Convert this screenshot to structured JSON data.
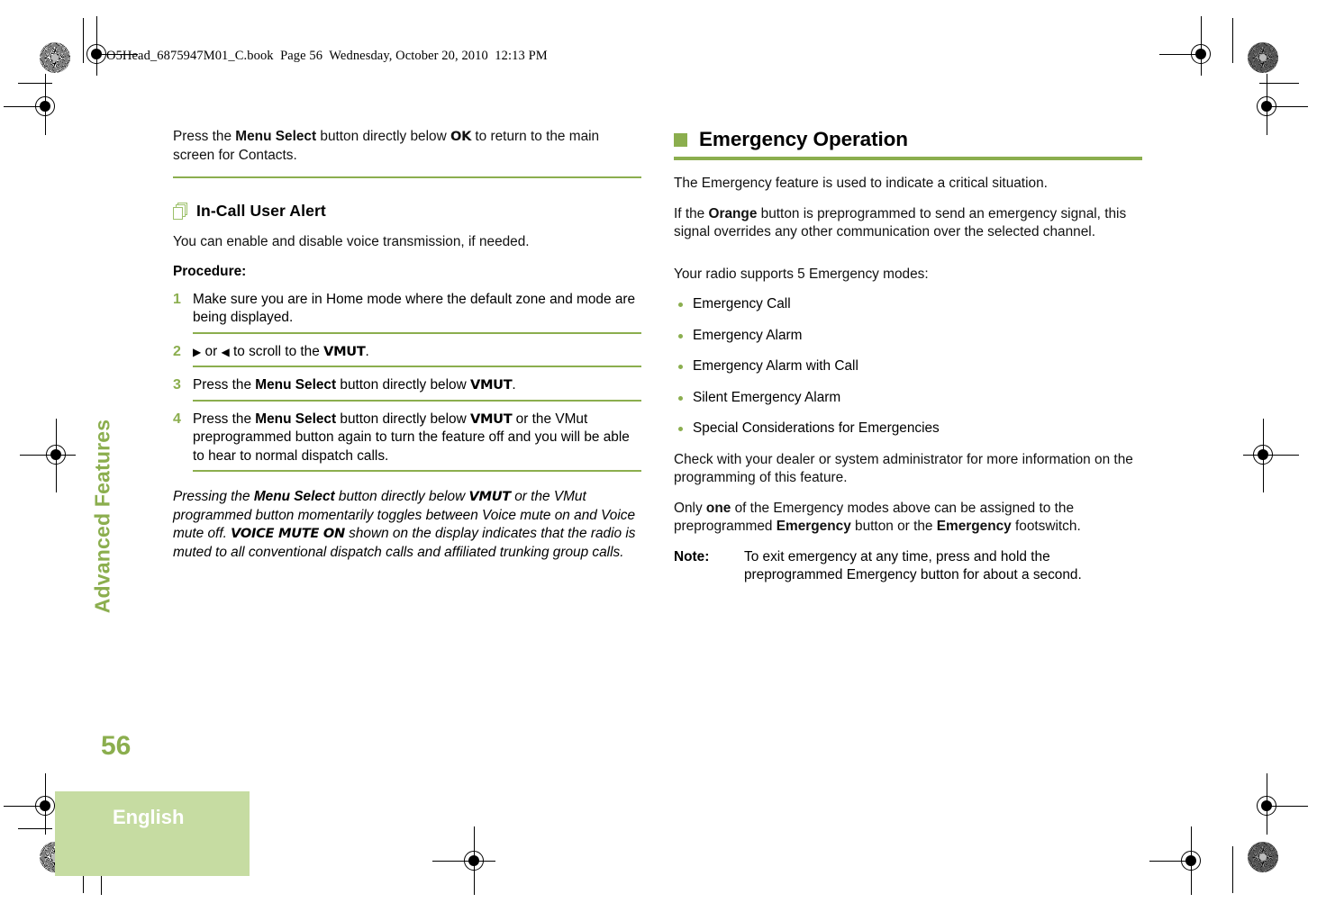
{
  "document": {
    "file_header": "O5Head_6875947M01_C.book  Page 56  Wednesday, October 20, 2010  12:13 PM",
    "chapter_tab": "Advanced Features",
    "page_number": "56",
    "language_label": "English",
    "accent_color": "#8BAE4E",
    "light_accent_color": "#C6DCA2"
  },
  "left_column": {
    "intro": {
      "part1": "Press the ",
      "bold1": "Menu Select",
      "part2": " button directly below ",
      "display1": "OK",
      "part3": " to return to the main screen for Contacts."
    },
    "subhead": {
      "icon": "stacked-pages-icon",
      "text": "In-Call User Alert"
    },
    "lead": "You can enable and disable voice transmission, if needed.",
    "procedure_label": "Procedure:",
    "steps": [
      {
        "num": "1",
        "part1": "Make sure you are in Home mode where the default zone and mode are being displayed."
      },
      {
        "num": "2",
        "arrow_right": "▶",
        "part1": " or ",
        "arrow_left": "◀",
        "part2": " to scroll to the ",
        "display1": "VMUT",
        "part3": "."
      },
      {
        "num": "3",
        "part1": "Press the ",
        "bold1": "Menu Select",
        "part2": " button directly below ",
        "display1": "VMUT",
        "part3": "."
      },
      {
        "num": "4",
        "part1": "Press the ",
        "bold1": "Menu Select",
        "part2": " button directly below ",
        "display1": "VMUT",
        "part3": " or the VMut preprogrammed button again to turn the feature off and you will be able to hear to normal dispatch calls."
      }
    ],
    "closing_note": {
      "part1": "Pressing the ",
      "bold1": "Menu Select",
      "part2": " button directly below ",
      "display1": "VMUT",
      "part3": " or the VMut programmed button momentarily toggles between Voice mute on and Voice mute off. ",
      "display2": "VOICE MUTE ON",
      "part4": " shown on the display indicates that the radio is muted to all conventional dispatch calls and affiliated trunking group calls."
    }
  },
  "right_column": {
    "heading": "Emergency Operation",
    "para1": "The Emergency feature is used to indicate a critical situation.",
    "para2": {
      "part1": "If the ",
      "bold1": "Orange",
      "part2": " button is preprogrammed to send an emergency signal, this signal overrides any other communication over the selected channel."
    },
    "modes_intro": "Your radio supports 5 Emergency modes:",
    "modes": [
      "Emergency Call",
      "Emergency Alarm",
      "Emergency Alarm with Call",
      "Silent Emergency Alarm",
      "Special Considerations for Emergencies"
    ],
    "para3": "Check with your dealer or system administrator for more information on the programming of this feature.",
    "para4": {
      "part1": "Only ",
      "bold1": "one",
      "part2": " of the Emergency modes above can be assigned to the preprogrammed ",
      "bold2": "Emergency",
      "part3": " button or the ",
      "bold3": "Emergency",
      "part4": " footswitch."
    },
    "note": {
      "key": "Note:",
      "value": "To exit emergency at any time, press and hold the preprogrammed Emergency button for about a second."
    }
  }
}
